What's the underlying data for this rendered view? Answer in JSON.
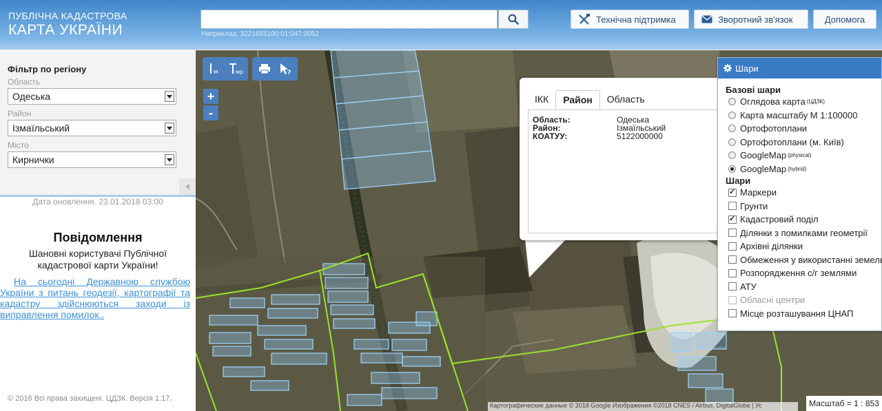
{
  "header": {
    "logo_line1": "ПУБЛІЧНА КАДАСТРОВА",
    "logo_line2": "КАРТА УКРАЇНИ",
    "search_value": "",
    "search_hint": "Наприклад: 3221655100:01:047:0052",
    "support_label": "Технічна підтримка",
    "feedback_label": "Зворотний зв'язок",
    "help_label": "Допомога"
  },
  "filter": {
    "title": "Фільтр по регіону",
    "region_label": "Область",
    "region_value": "Одеська",
    "district_label": "Район",
    "district_value": "Ізмаїльський",
    "city_label": "Місто",
    "city_value": "Кирнички",
    "updated": "Дата оновлення. 23.01.2018 03:00"
  },
  "notice": {
    "title": "Повідомлення",
    "text": "Шановні користувачі Публічної кадастрової карти України!",
    "link": "На сьогодні Державною службою України з питань геодезії, картографії та кадастру здійснюються заходи із виправлення помилок.."
  },
  "footer": {
    "copyright": "© 2016 Всі права захищені. ЦДЗК. Версія 1.17."
  },
  "map": {
    "tools": [
      "Iм",
      "Tмр",
      "print",
      "info"
    ],
    "zoom_in": "+",
    "zoom_out": "-",
    "attribution": "Картографические данные © 2018 Google Изображения ©2018 CNES / Airbus, DigitalGlobe | Ус",
    "scale": "Масштаб = 1 : 853"
  },
  "popup": {
    "tabs": [
      "ІКК",
      "Район",
      "Область"
    ],
    "active_tab": "Район",
    "rows": [
      {
        "key": "Область:",
        "value": "Одеська"
      },
      {
        "key": "Район:",
        "value": "Ізмаїльський"
      },
      {
        "key": "КОАТУУ:",
        "value": "5122000000"
      }
    ]
  },
  "layers": {
    "title": "Шари",
    "base_title": "Базові шари",
    "base": [
      {
        "label": "Оглядова карта",
        "sup": "(ЦДЗК)",
        "checked": false
      },
      {
        "label": "Карта масштабу М 1:100000",
        "sup": "",
        "checked": false
      },
      {
        "label": "Ортофотоплани",
        "sup": "",
        "checked": false
      },
      {
        "label": "Ортофотоплани (м. Київ)",
        "sup": "",
        "checked": false
      },
      {
        "label": "GoogleMap",
        "sup": "(physical)",
        "checked": false
      },
      {
        "label": "GoogleMap",
        "sup": "(hybrid)",
        "checked": true
      }
    ],
    "layers_title": "Шари",
    "items": [
      {
        "label": "Маркери",
        "checked": true,
        "disabled": false
      },
      {
        "label": "Грунти",
        "checked": false,
        "disabled": false
      },
      {
        "label": "Кадастровий поділ",
        "checked": true,
        "disabled": false
      },
      {
        "label": "Ділянки з помилками геометрії",
        "checked": false,
        "disabled": false
      },
      {
        "label": "Архівні ділянки",
        "checked": false,
        "disabled": false
      },
      {
        "label": "Обмеження у використанні земель",
        "checked": false,
        "disabled": false
      },
      {
        "label": "Розпорядження с/г землями",
        "checked": false,
        "disabled": false
      },
      {
        "label": "АТУ",
        "checked": false,
        "disabled": false
      },
      {
        "label": "Обласні центри",
        "checked": false,
        "disabled": true
      },
      {
        "label": "Місце розташування ЦНАП",
        "checked": false,
        "disabled": false
      }
    ]
  },
  "colors": {
    "header_blue": "#3f86cc",
    "accent": "#3a7bc6",
    "parcel": "#8ecbff",
    "boundary": "#9be22c"
  }
}
